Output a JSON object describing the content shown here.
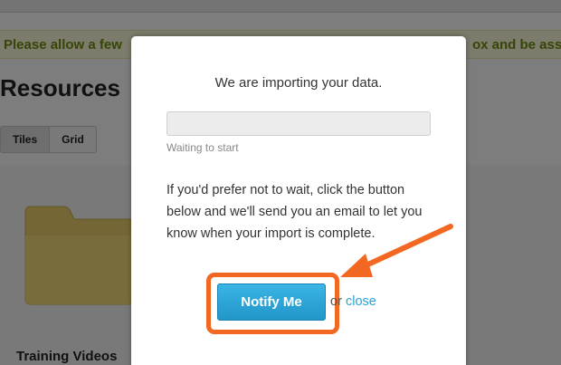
{
  "background": {
    "notice_left": "Please allow a few",
    "notice_right": "ox and be asso",
    "page_title": "Resources",
    "view_toggle": {
      "tiles_label": "Tiles",
      "grid_label": "Grid"
    },
    "folder_label": "Training Videos",
    "icons": {
      "folder": "folder-icon"
    }
  },
  "modal": {
    "title": "We are importing your data.",
    "progress": {
      "fraction": 0,
      "status": "Waiting to start"
    },
    "message": "If you'd prefer not to wait, click the button below and we'll send you an email to let you know when your import is complete.",
    "notify_button": "Notify Me",
    "or_text": "or",
    "close_link": "close"
  },
  "annotation": {
    "arrow_icon": "arrow-icon",
    "color": "#f26722"
  },
  "colors": {
    "accent": "#2aa3d6",
    "button": "#2296c8",
    "highlight": "#f26722",
    "notice_text": "#6f8a12"
  }
}
